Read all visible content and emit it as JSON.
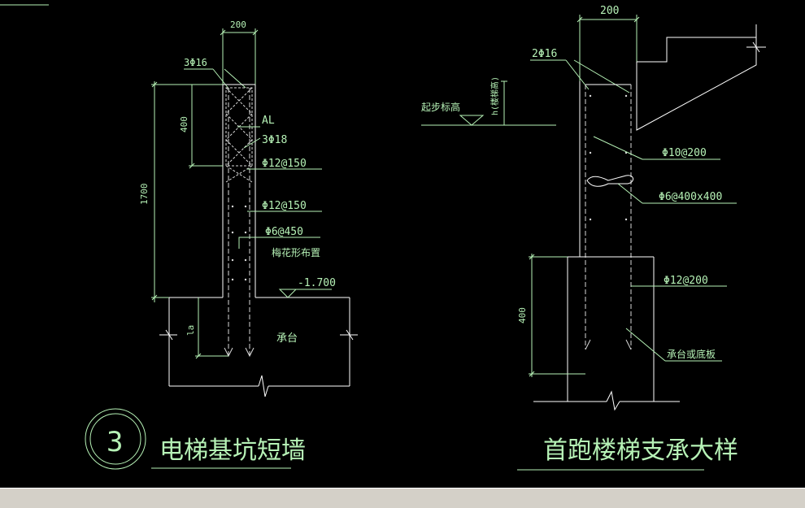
{
  "colors": {
    "background": "#000000",
    "outline": "#ffffff",
    "annotation": "#b6f2b6",
    "rebar": "#d9d9d9",
    "statusbar": "#d4d0c8"
  },
  "left_detail": {
    "width_dim": "200",
    "top_bars": "3Φ16",
    "height_dim_total": "1700",
    "height_dim_upper": "400",
    "embed_dim": "la",
    "beam_label": "AL",
    "beam_bars": "3Φ18",
    "rebar_1": "Φ12@150",
    "rebar_2": "Φ12@150",
    "ties": "Φ6@450",
    "ties_note": "梅花形布置",
    "elevation": "-1.700",
    "cap_label": "承台",
    "number": "3",
    "title": "电梯基坑短墙"
  },
  "right_detail": {
    "width_dim": "200",
    "top_bars": "2Φ16",
    "step_label": "起步标高",
    "step_dim": "h(楼梯高)",
    "stirrups": "Φ10@200",
    "ties": "Φ6@400x400",
    "lower_bars": "Φ12@200",
    "depth_dim": "400",
    "cap_label": "承台或底板",
    "title": "首跑楼梯支承大样"
  },
  "statusbar": {
    "text": ""
  }
}
